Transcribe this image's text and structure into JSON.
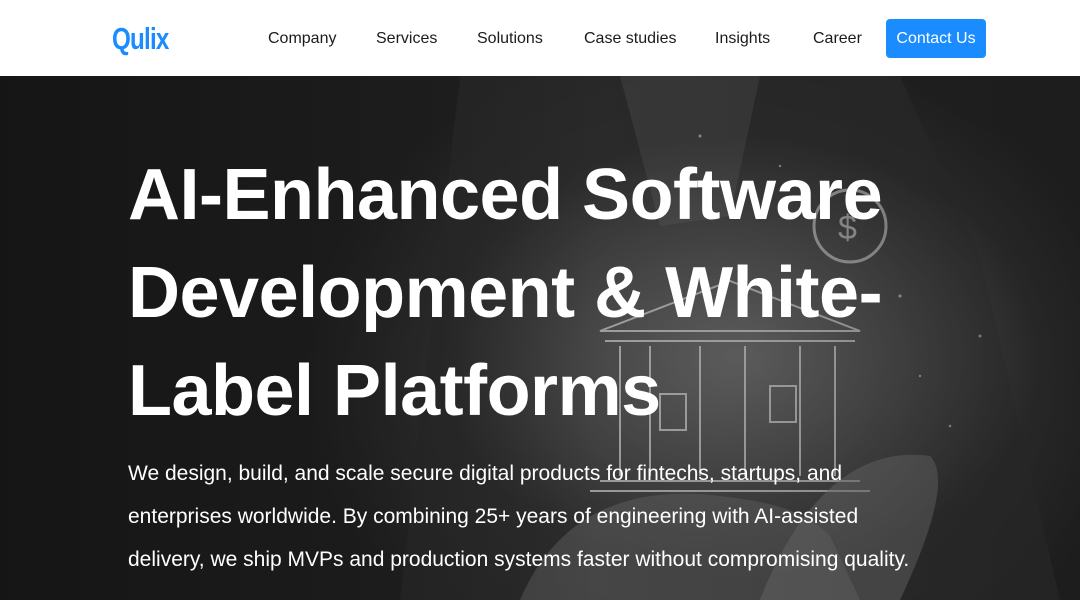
{
  "header": {
    "logo": "Qulix",
    "nav": [
      "Company",
      "Services",
      "Solutions",
      "Case studies",
      "Insights",
      "Career"
    ],
    "contact_label": "Contact Us"
  },
  "hero": {
    "title_lines": [
      "AI-Enhanced Software",
      "Development & White-",
      "Label Platforms"
    ],
    "description_lines": [
      "We design, build, and scale secure digital products for fintechs, startups, and",
      "enterprises worldwide. By combining 25+ years of engineering with AI-assisted",
      "delivery, we ship MVPs and production systems faster without compromising quality."
    ]
  },
  "colors": {
    "accent": "#1a8cff",
    "hero_background": "#2a2a2a",
    "text_dark": "#1b1b1b"
  }
}
